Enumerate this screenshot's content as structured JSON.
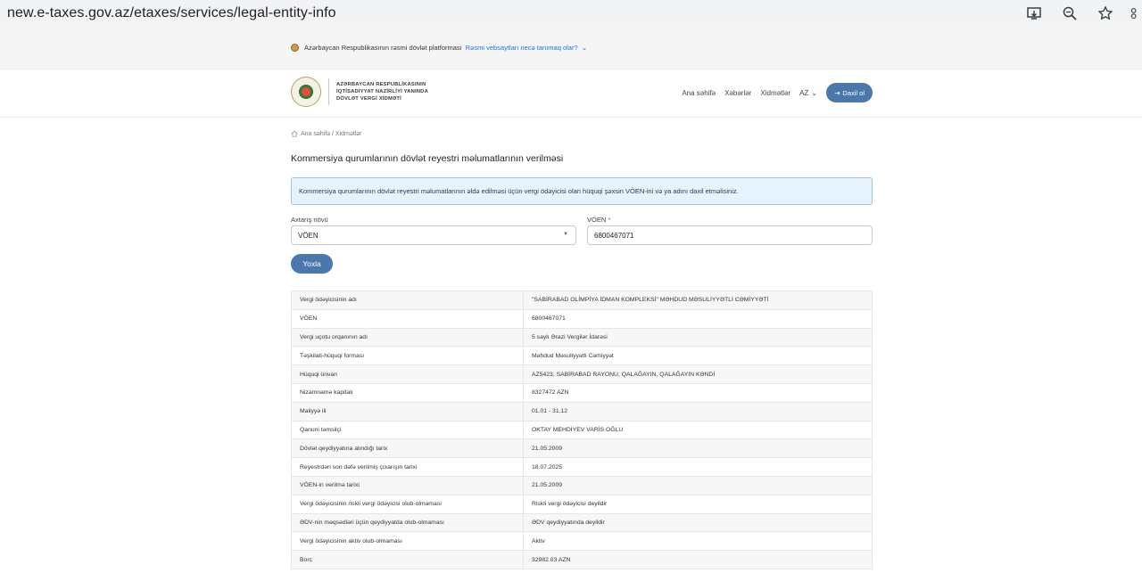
{
  "browser": {
    "url": "new.e-taxes.gov.az/etaxes/services/legal-entity-info",
    "icons": [
      "install-icon",
      "zoom-icon",
      "star-icon",
      "extensions-icon"
    ]
  },
  "banner": {
    "text": "Azərbaycan Respublikasının rəsmi dövlət platforması",
    "link": "Rəsmi vebsaytları necə tanımaq olar?"
  },
  "header": {
    "logo_line1": "AZƏRBAYCAN RESPUBLİKASININ",
    "logo_line2": "İQTİSADİYYAT NAZİRLİYİ YANINDA",
    "logo_line3": "DÖVLƏT VERGİ XİDMƏTİ",
    "nav": [
      "Ana səhifə",
      "Xəbərlər",
      "Xidmətlər"
    ],
    "lang": "AZ",
    "login": "Daxil ol"
  },
  "breadcrumb": "Ana səhifə / Xidmətlər",
  "page_title": "Kommersiya qurumlarının dövlət reyestri məlumatlarının verilməsi",
  "info": "Kommersiya qurumlarının dövlət reyestri məlumatlarının əldə edilməsi üçün vergi ödəyicisi olan hüquqi şəxsin VÖEN-ini və ya adını daxil etməlisiniz.",
  "form": {
    "search_type_label": "Axtarış növü",
    "search_type_value": "VÖEN",
    "voen_label": "VÖEN",
    "voen_required": "*",
    "voen_value": "6800467071",
    "submit": "Yoxla"
  },
  "result": [
    {
      "key": "Vergi ödəyicisinin adı",
      "value": "\"SABİRABAD OLİMPİYA İDMAN KOMPLEKSİ\" MƏHDUD MƏSULİYYƏTLİ CƏMİYYƏTİ"
    },
    {
      "key": "VÖEN",
      "value": "6800467071"
    },
    {
      "key": "Vergi uçotu orqanının adı",
      "value": "5 saylı Ərazi Vergilər İdarəsi"
    },
    {
      "key": "Təşkilati-hüquqi forması",
      "value": "Məhdud Məsuliyyətli Cəmiyyət"
    },
    {
      "key": "Hüquqi ünvan",
      "value": "AZ5423, SABİRABAD RAYONU, QALAĞAYIN, QALAĞAYIN KƏNDİ"
    },
    {
      "key": "Nizamnamə kapitalı",
      "value": "8327472 AZN"
    },
    {
      "key": "Maliyyə ili",
      "value": "01.01 - 31.12"
    },
    {
      "key": "Qanuni təmsilçi",
      "value": "OKTAY MEHDİYEV VARİS OĞLU"
    },
    {
      "key": "Dövlət qeydiyyatına alındığı tarix",
      "value": "21.05.2009"
    },
    {
      "key": "Reyestrdən son dəfə verilmiş çıxarışın tarixi",
      "value": "18.07.2025"
    },
    {
      "key": "VÖEN-in verilmə tarixi",
      "value": "21.05.2009"
    },
    {
      "key": "Vergi ödəyicisinin riskli vergi ödəyicisi olub-olmaması",
      "value": "Riskli vergi ödəyicisi deyildir"
    },
    {
      "key": "ƏDV-nin məqsədləri üçün qeydiyyatda olub-olmaması",
      "value": "ƏDV qeydiyyatında deyildir"
    },
    {
      "key": "Vergi ödəyicisinin aktiv olub-olmaması",
      "value": "Aktiv"
    },
    {
      "key": "Borc",
      "value": "32982.03 AZN"
    }
  ]
}
